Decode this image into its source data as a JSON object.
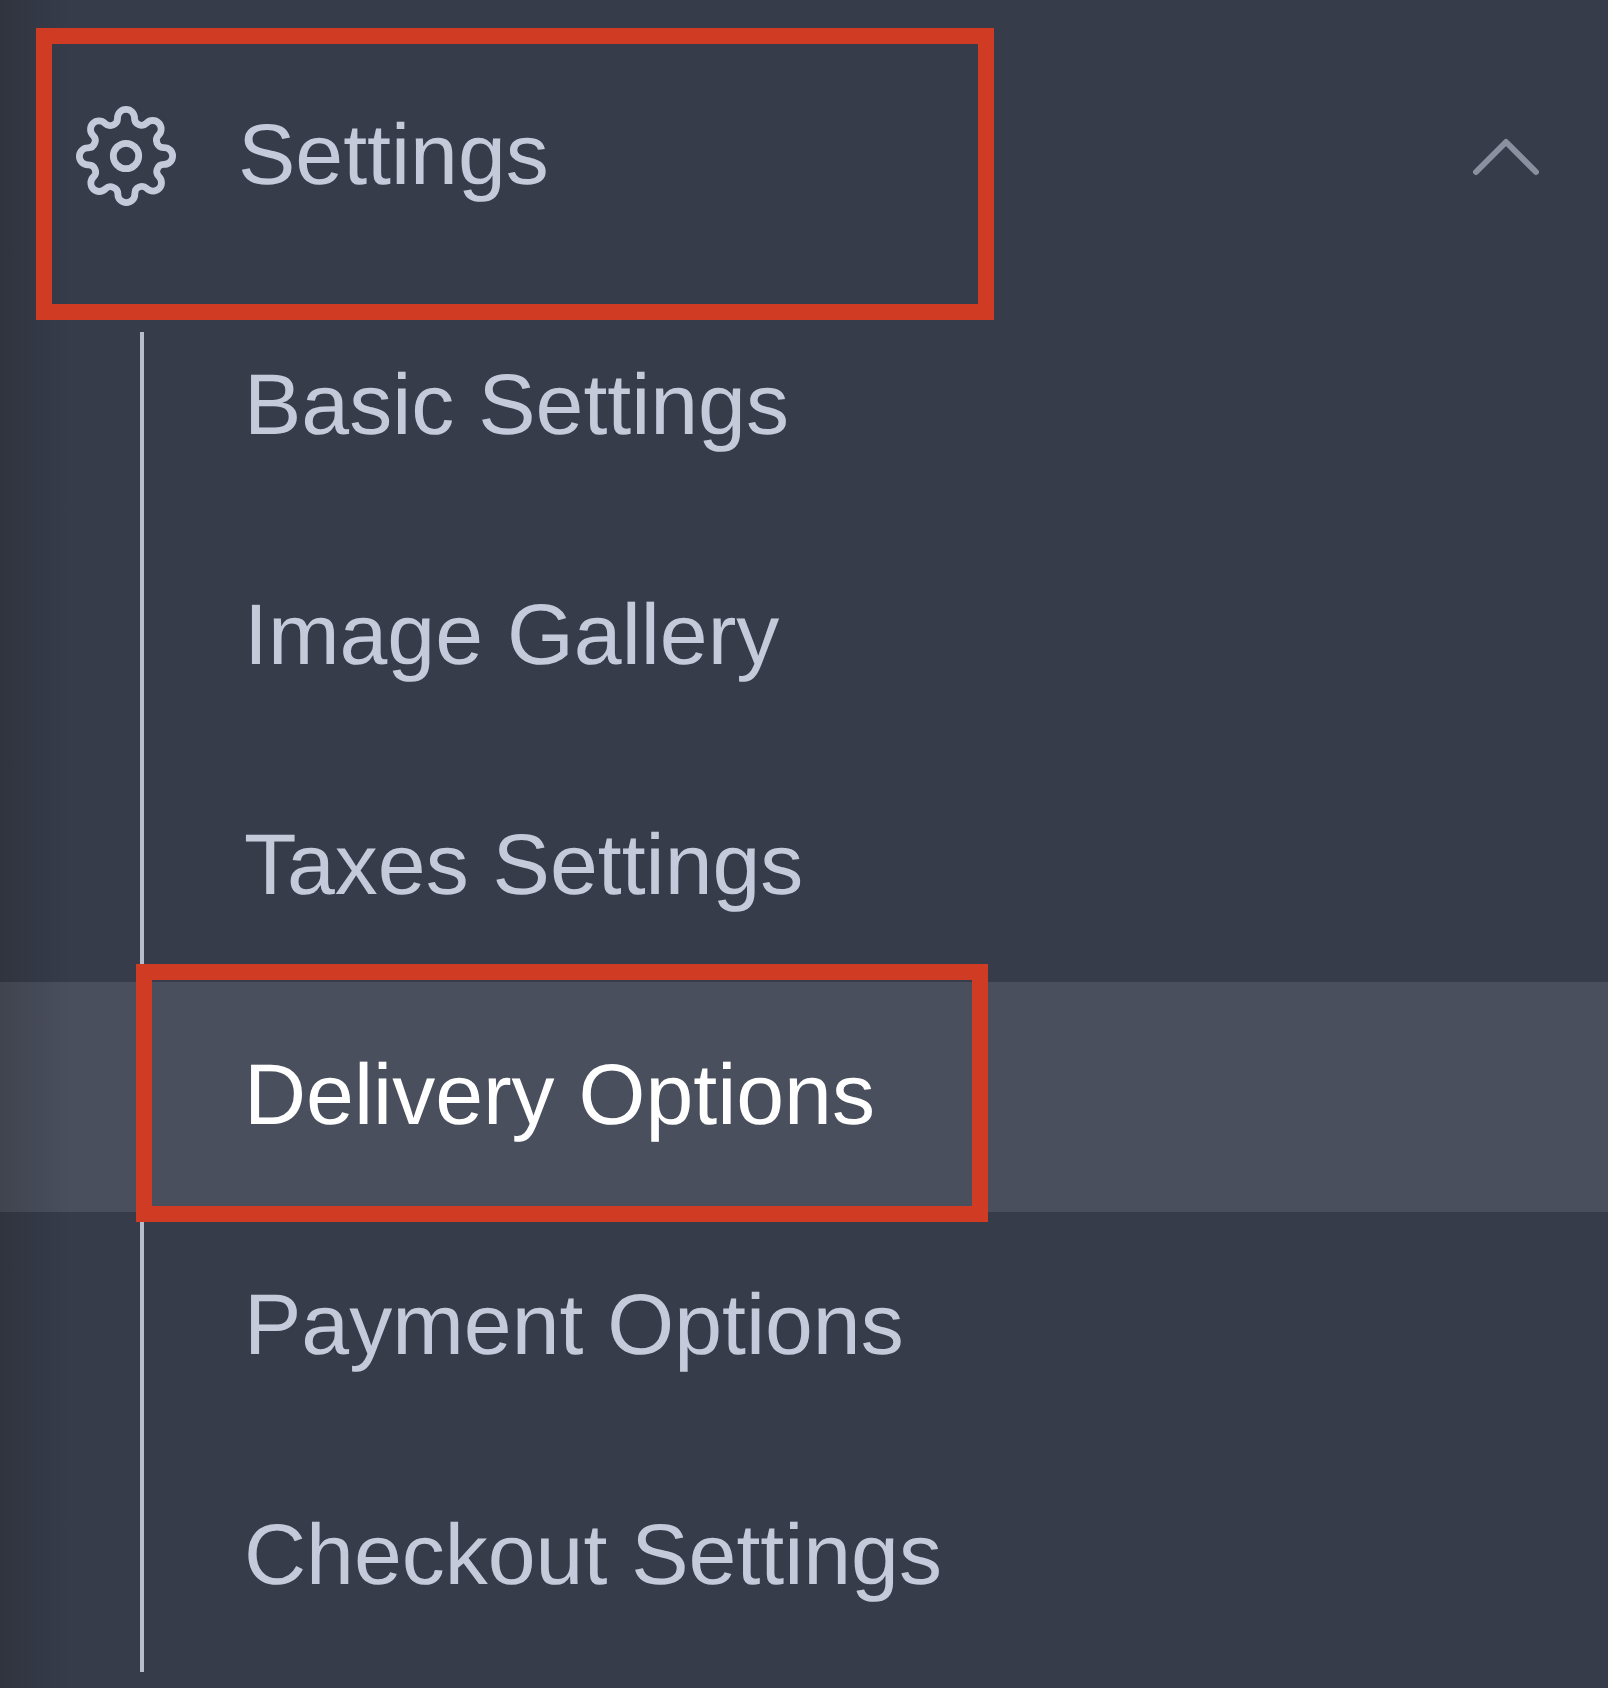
{
  "section": {
    "title": "Settings",
    "expanded": true,
    "highlighted": true,
    "items": [
      {
        "label": "Basic Settings",
        "selected": false,
        "highlighted": false
      },
      {
        "label": "Image Gallery",
        "selected": false,
        "highlighted": false
      },
      {
        "label": "Taxes Settings",
        "selected": false,
        "highlighted": false
      },
      {
        "label": "Delivery Options",
        "selected": true,
        "highlighted": true
      },
      {
        "label": "Payment Options",
        "selected": false,
        "highlighted": false
      },
      {
        "label": "Checkout Settings",
        "selected": false,
        "highlighted": false
      }
    ]
  }
}
